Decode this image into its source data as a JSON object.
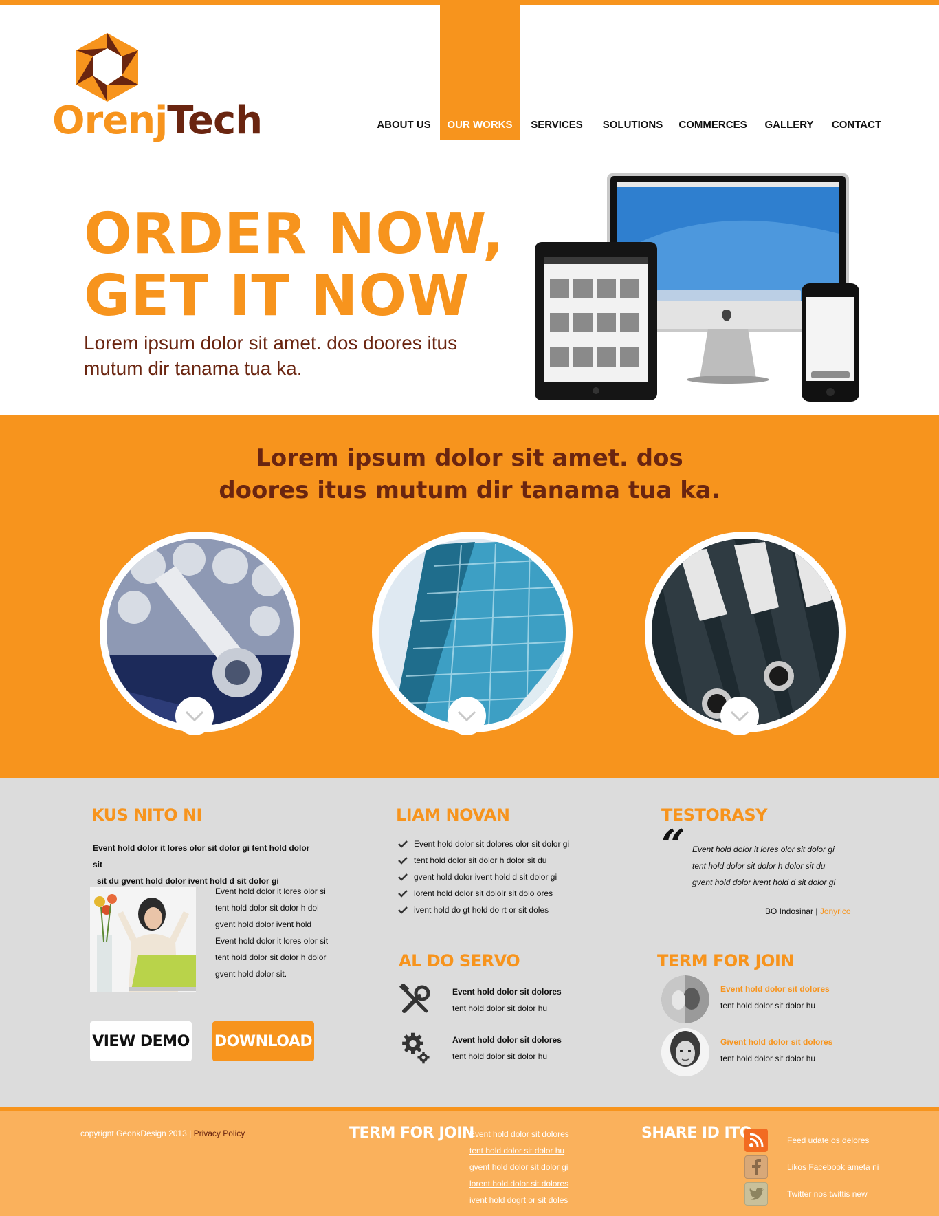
{
  "brand": {
    "logo_part1": "Orenj",
    "logo_part2": "Tech"
  },
  "nav": [
    "ABOUT US",
    "OUR WORKS",
    "SERVICES",
    "SOLUTIONS",
    "COMMERCES",
    "GALLERY",
    "CONTACT"
  ],
  "nav_active": "OUR WORKS",
  "hero": {
    "title_line1": "ORDER NOW,",
    "title_line2": "GET IT NOW",
    "subtitle": "Lorem ipsum dolor sit amet. dos doores itus mutum dir tanama tua ka."
  },
  "band": {
    "line1": "Lorem ipsum dolor sit amet. dos",
    "line2": "doores itus mutum dir tanama tua ka."
  },
  "col1": {
    "heading": "KUS NITO NI",
    "lead_line1": "Event hold dolor it lores olor sit dolor gi tent hold dolor sit",
    "lead_line2": "sit du gvent hold dolor ivent hold d sit dolor gi",
    "body_lines": [
      "Event hold dolor it lores olor si",
      "tent hold dolor sit dolor h dol",
      "gvent hold dolor ivent hold",
      "Event hold dolor it lores olor sit",
      "tent hold dolor sit dolor h dolor",
      "gvent hold dolor sit."
    ],
    "btn_demo": "VIEW DEMO",
    "btn_download": "DOWNLOAD"
  },
  "col2": {
    "heading": "LIAM NOVAN",
    "checklist": [
      "Event hold dolor sit dolores olor sit dolor gi",
      "tent hold dolor sit dolor h dolor  sit du",
      "gvent hold dolor ivent hold d sit dolor gi",
      "lorent hold dolor sit dololr sit dolo ores",
      "ivent hold do gt hold do rt or sit doles"
    ],
    "services_heading": "AL DO SERVO",
    "services": [
      {
        "icon": "tools-icon",
        "title": "Event hold dolor sit dolores",
        "text": "tent hold dolor sit dolor hu"
      },
      {
        "icon": "gears-icon",
        "title": "Avent hold dolor sit dolores",
        "text": "tent hold dolor sit dolor hu"
      }
    ]
  },
  "col3": {
    "heading": "TESTORASY",
    "quote_lines": [
      "Event hold dolor it lores olor sit dolor gi",
      "tent hold dolor sit dolor h dolor  sit du",
      "gvent hold dolor ivent hold d sit dolor gi"
    ],
    "quote_source": "BO Indosinar | ",
    "quote_author": "Jonyrico",
    "join_heading": "TERM FOR JOIN",
    "members": [
      {
        "title": "Event hold dolor sit dolores",
        "text": "tent hold dolor sit dolor hu"
      },
      {
        "title": "Givent hold dolor sit dolores",
        "text": "tent hold dolor sit dolor hu"
      }
    ]
  },
  "footer": {
    "copyright": "copyrignt GeonkDesign 2013 | ",
    "privacy": "Privacy Policy",
    "join_heading": "TERM FOR JOIN",
    "links": [
      "Event hold dolor sit dolores",
      "tent hold dolor sit dolor hu",
      "gvent hold dolor sit dolor gi",
      "lorent hold dolor sit dolores",
      "ivent hold dogrt or sit doles"
    ],
    "share_heading": "SHARE ID ITO",
    "share": [
      {
        "icon": "rss-icon",
        "label": "Feed udate os delores"
      },
      {
        "icon": "facebook-icon",
        "label": "Likos Facebook ameta ni"
      },
      {
        "icon": "twitter-icon",
        "label": "Twitter nos twittis new"
      }
    ]
  },
  "colors": {
    "orange": "#f7941d",
    "brown": "#6a2510",
    "grey": "#dcdcdc",
    "footer": "#fab15c"
  }
}
